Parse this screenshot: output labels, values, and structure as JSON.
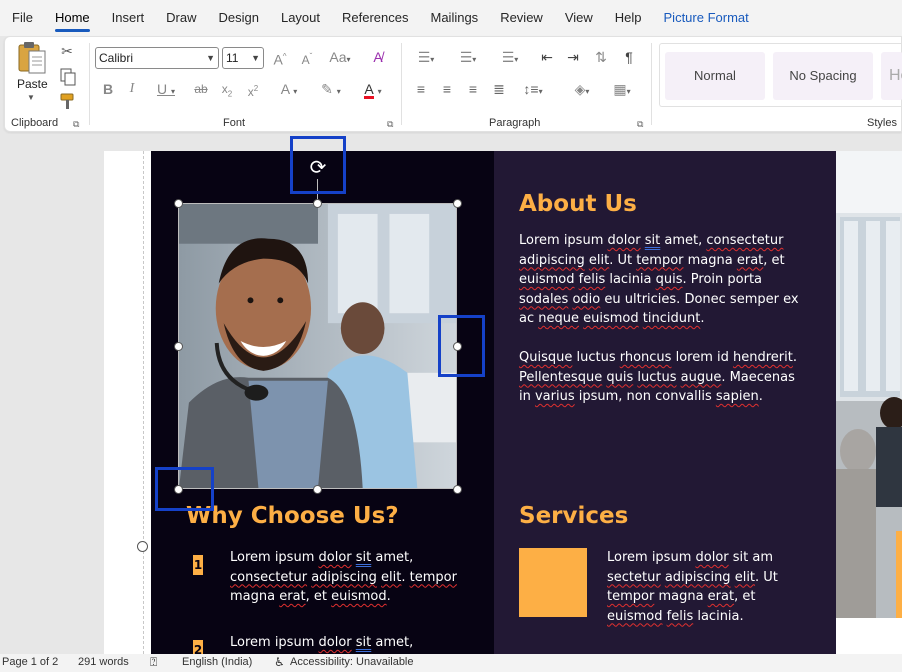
{
  "menu": {
    "tabs": [
      "File",
      "Home",
      "Insert",
      "Draw",
      "Design",
      "Layout",
      "References",
      "Mailings",
      "Review",
      "View",
      "Help",
      "Picture Format"
    ],
    "active_index": 1,
    "accent_color": "#185abd"
  },
  "ribbon": {
    "clipboard": {
      "label": "Clipboard",
      "paste_label": "Paste"
    },
    "font": {
      "label": "Font",
      "font_name": "Calibri",
      "font_size": "11"
    },
    "paragraph": {
      "label": "Paragraph"
    },
    "styles": {
      "label": "Styles",
      "items": [
        "Normal",
        "No Spacing",
        "He"
      ]
    }
  },
  "document": {
    "about": {
      "heading": "About Us",
      "p1": [
        "Lorem ipsum ",
        "dolor",
        " ",
        "sit",
        " amet, ",
        "consectetur",
        " ",
        "adipiscing",
        " ",
        "elit",
        ". Ut ",
        "tempor",
        " magna ",
        "erat",
        ", et ",
        "euismod",
        " ",
        "felis",
        " lacinia ",
        "quis",
        ". Proin porta ",
        "sodales",
        " ",
        "odio",
        " eu ultricies. Donec semper ex ac ",
        "neque",
        " ",
        "euismod",
        " ",
        "tincidunt",
        "."
      ],
      "p2": [
        "Quisque",
        " luctus ",
        "rhoncus",
        "  lorem id ",
        "hendrerit",
        ". ",
        "Pellentesque",
        " ",
        "quis",
        " ",
        "luctus",
        " ",
        "augue",
        ". Maecenas in ",
        "varius",
        " ipsum, non convallis ",
        "sapien",
        "."
      ]
    },
    "why": {
      "heading": "Why Choose Us?",
      "item1_number": "1",
      "item1": [
        "Lorem ipsum ",
        "dolor",
        " ",
        "sit",
        " amet, ",
        "consectetur",
        " ",
        "adipiscing",
        " ",
        "elit",
        ". ",
        "tempor",
        " magna ",
        "erat",
        ", et ",
        "euismod",
        "."
      ],
      "item2_number": "2",
      "item2": [
        "Lorem ipsum ",
        "dolor",
        " ",
        "sit",
        " amet,"
      ]
    },
    "services": {
      "heading": "Services",
      "text": [
        "Lorem ipsum ",
        "dolor",
        "  sit am",
        " sectetur",
        "  ",
        "adipiscing",
        "  ",
        "elit",
        ". Ut ",
        "tempor",
        " magna ",
        "erat",
        ", et ",
        "euismod",
        " ",
        "felis",
        " lacinia."
      ]
    },
    "colors": {
      "accent_orange": "#fdaf45",
      "panel_dark": "#070313",
      "panel_purple": "#221834",
      "highlight_blue": "#1541c8"
    }
  },
  "status": {
    "page": "Page 1 of 2",
    "words": "291 words",
    "language": "English (India)",
    "accessibility": "Accessibility: Unavailable"
  }
}
